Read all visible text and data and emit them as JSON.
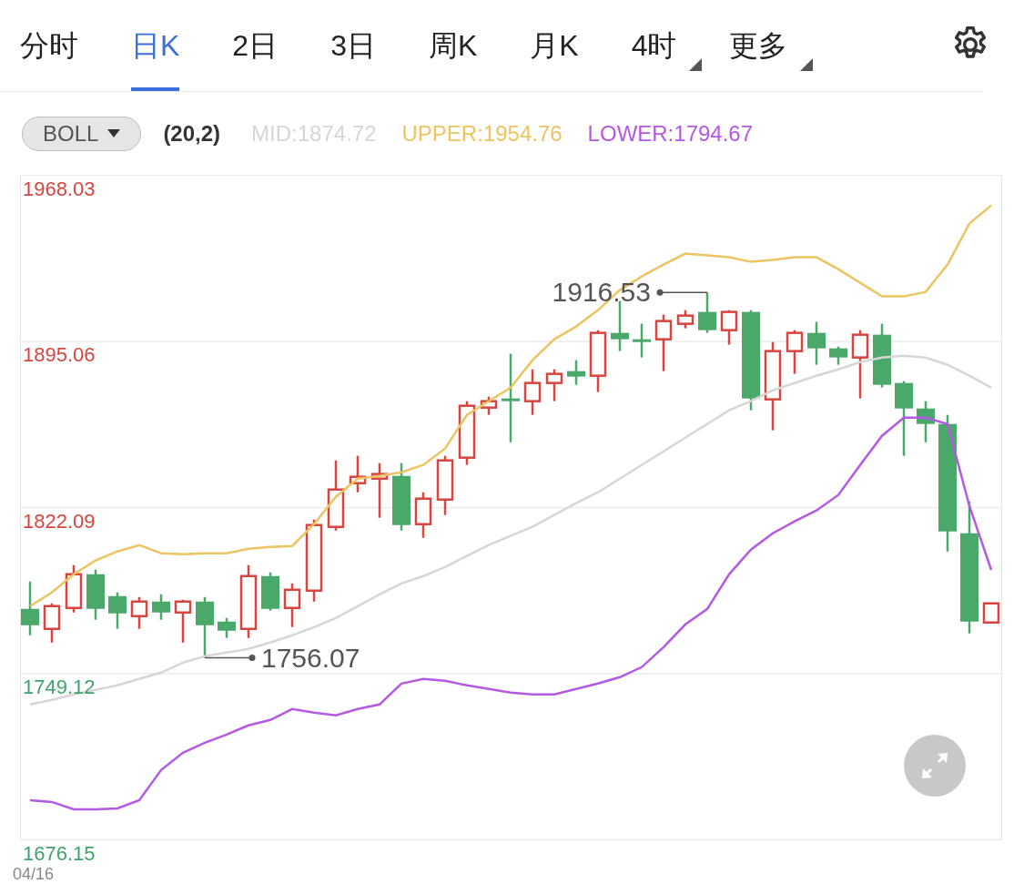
{
  "tabs": [
    {
      "label": "分时",
      "selected": false,
      "has_menu": false
    },
    {
      "label": "日K",
      "selected": true,
      "has_menu": false
    },
    {
      "label": "2日",
      "selected": false,
      "has_menu": false
    },
    {
      "label": "3日",
      "selected": false,
      "has_menu": false
    },
    {
      "label": "周K",
      "selected": false,
      "has_menu": false
    },
    {
      "label": "月K",
      "selected": false,
      "has_menu": false
    },
    {
      "label": "4时",
      "selected": false,
      "has_menu": true
    },
    {
      "label": "更多",
      "selected": false,
      "has_menu": true
    }
  ],
  "indicator": {
    "name": "BOLL",
    "params": "(20,2)",
    "mid": "MID:1874.72",
    "upper": "UPPER:1954.76",
    "lower": "LOWER:1794.67"
  },
  "chart": {
    "chart_data": {
      "type": "candlestick",
      "grid": true,
      "ylim": [
        1676.15,
        1968.03
      ],
      "yticks": [
        {
          "value": 1968.03,
          "label": "1968.03"
        },
        {
          "value": 1895.06,
          "label": "1895.06"
        },
        {
          "value": 1822.09,
          "label": "1822.09"
        },
        {
          "value": 1749.12,
          "label": "1749.12"
        },
        {
          "value": 1676.15,
          "label": "1676.15"
        }
      ],
      "ohlc": [
        [
          1777.6,
          1789.6,
          1766.0,
          1770.4
        ],
        [
          1768.8,
          1780.0,
          1762.8,
          1778.8
        ],
        [
          1778.0,
          1796.8,
          1776.0,
          1792.8
        ],
        [
          1792.8,
          1794.8,
          1772.8,
          1777.6
        ],
        [
          1783.2,
          1784.8,
          1768.8,
          1775.6
        ],
        [
          1774.4,
          1782.8,
          1768.8,
          1780.8
        ],
        [
          1780.8,
          1784.0,
          1772.8,
          1776.0
        ],
        [
          1776.0,
          1781.6,
          1762.8,
          1780.8
        ],
        [
          1780.8,
          1782.8,
          1756.07,
          1770.4
        ],
        [
          1772.0,
          1773.6,
          1764.8,
          1768.0
        ],
        [
          1768.8,
          1796.8,
          1764.8,
          1792.0
        ],
        [
          1792.0,
          1793.6,
          1776.8,
          1777.6
        ],
        [
          1778.0,
          1788.8,
          1769.6,
          1786.0
        ],
        [
          1785.6,
          1816.8,
          1780.8,
          1814.4
        ],
        [
          1813.6,
          1842.8,
          1812.0,
          1830.0
        ],
        [
          1832.8,
          1844.8,
          1828.8,
          1835.6
        ],
        [
          1834.8,
          1841.6,
          1817.6,
          1836.8
        ],
        [
          1836.0,
          1841.6,
          1812.0,
          1814.4
        ],
        [
          1814.8,
          1828.8,
          1808.8,
          1826.0
        ],
        [
          1825.6,
          1844.8,
          1818.8,
          1842.8
        ],
        [
          1844.0,
          1868.8,
          1840.8,
          1866.8
        ],
        [
          1866.0,
          1870.8,
          1862.8,
          1868.8
        ],
        [
          1870.0,
          1889.6,
          1850.8,
          1868.8
        ],
        [
          1868.8,
          1882.8,
          1862.8,
          1876.8
        ],
        [
          1876.8,
          1882.8,
          1868.8,
          1880.8
        ],
        [
          1882.0,
          1886.8,
          1876.0,
          1879.6
        ],
        [
          1880.0,
          1900.0,
          1872.8,
          1898.8
        ],
        [
          1898.8,
          1912.8,
          1890.8,
          1896.0
        ],
        [
          1896.0,
          1902.8,
          1888.0,
          1895.2
        ],
        [
          1896.0,
          1906.8,
          1882.0,
          1904.0
        ],
        [
          1902.8,
          1908.8,
          1900.8,
          1906.4
        ],
        [
          1908.0,
          1916.53,
          1898.8,
          1900.0
        ],
        [
          1900.0,
          1908.8,
          1893.6,
          1908.0
        ],
        [
          1908.0,
          1908.8,
          1864.8,
          1870.0
        ],
        [
          1869.6,
          1894.8,
          1856.0,
          1890.8
        ],
        [
          1890.8,
          1900.0,
          1880.8,
          1898.8
        ],
        [
          1898.8,
          1903.6,
          1884.8,
          1892.0
        ],
        [
          1892.0,
          1892.8,
          1884.8,
          1888.0
        ],
        [
          1888.0,
          1900.0,
          1870.0,
          1898.0
        ],
        [
          1898.0,
          1902.8,
          1874.8,
          1876.0
        ],
        [
          1876.8,
          1877.6,
          1844.8,
          1865.6
        ],
        [
          1865.6,
          1868.8,
          1850.8,
          1858.8
        ],
        [
          1858.8,
          1862.8,
          1802.8,
          1811.6
        ],
        [
          1810.8,
          1824.8,
          1766.8,
          1772.0
        ],
        [
          1771.6,
          1780.0,
          1771.6,
          1780.0
        ]
      ],
      "series": [
        {
          "type": "line",
          "color": "#d6d6d6",
          "values": [
            1735.6,
            1737.6,
            1740.0,
            1742.0,
            1744.0,
            1746.8,
            1749.6,
            1754.0,
            1756.8,
            1758.4,
            1760.0,
            1762.8,
            1766.0,
            1769.6,
            1773.6,
            1778.8,
            1784.0,
            1788.8,
            1792.0,
            1796.0,
            1800.8,
            1805.6,
            1809.6,
            1813.6,
            1818.8,
            1824.0,
            1828.8,
            1834.8,
            1840.8,
            1846.8,
            1852.8,
            1858.8,
            1864.8,
            1868.8,
            1873.6,
            1876.8,
            1880.0,
            1882.8,
            1886.0,
            1888.0,
            1888.8,
            1888.0,
            1884.8,
            1880.0,
            1874.7
          ]
        },
        {
          "type": "line",
          "color": "#ecc462",
          "values": [
            1778.8,
            1784.8,
            1792.8,
            1798.8,
            1802.8,
            1805.6,
            1802.0,
            1801.6,
            1802.0,
            1802.0,
            1804.0,
            1804.8,
            1805.2,
            1814.8,
            1826.8,
            1834.8,
            1836.0,
            1837.6,
            1840.8,
            1848.0,
            1862.8,
            1868.8,
            1874.8,
            1886.8,
            1896.0,
            1901.6,
            1908.8,
            1917.6,
            1923.6,
            1928.8,
            1933.6,
            1932.8,
            1932.0,
            1930.0,
            1930.8,
            1932.0,
            1932.0,
            1926.8,
            1920.8,
            1914.8,
            1914.8,
            1916.8,
            1928.8,
            1946.8,
            1954.8
          ]
        },
        {
          "type": "line",
          "color": "#b459e3",
          "values": [
            1693.6,
            1692.8,
            1689.6,
            1689.6,
            1690.0,
            1693.6,
            1706.8,
            1714.4,
            1718.8,
            1722.4,
            1726.4,
            1728.8,
            1733.6,
            1732.0,
            1730.8,
            1733.6,
            1735.6,
            1744.8,
            1746.8,
            1746.0,
            1744.0,
            1742.4,
            1740.8,
            1740.0,
            1740.0,
            1742.4,
            1744.8,
            1747.6,
            1752.0,
            1760.8,
            1770.8,
            1777.6,
            1792.8,
            1803.6,
            1810.8,
            1816.0,
            1820.8,
            1827.6,
            1840.8,
            1853.6,
            1861.6,
            1861.6,
            1858.8,
            1822.8,
            1794.7
          ]
        }
      ],
      "annotations": [
        "1916.53",
        "1756.07"
      ]
    },
    "date_label": "04/16"
  }
}
